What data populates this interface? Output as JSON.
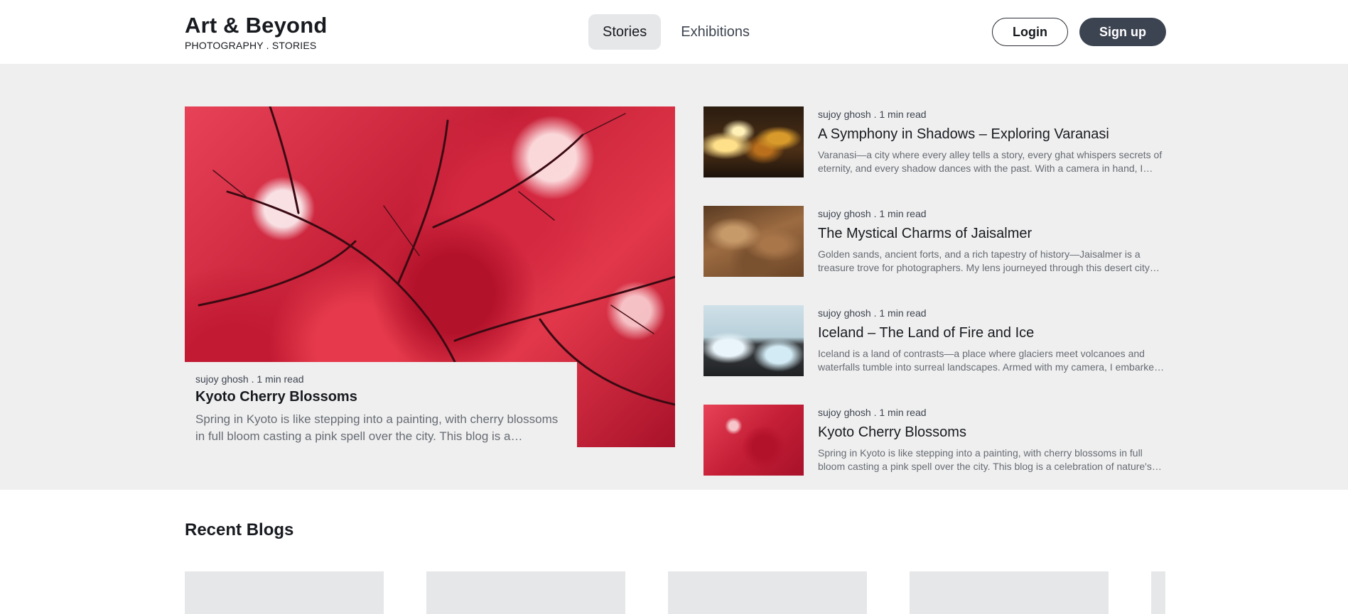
{
  "header": {
    "brand_title": "Art & Beyond",
    "brand_subtitle": "PHOTOGRAPHY . STORIES",
    "nav": [
      {
        "label": "Stories",
        "active": true
      },
      {
        "label": "Exhibitions",
        "active": false
      }
    ],
    "login_label": "Login",
    "signup_label": "Sign up"
  },
  "featured": {
    "meta": "sujoy ghosh . 1 min read",
    "title": "Kyoto Cherry Blossoms",
    "excerpt": "Spring in Kyoto is like stepping into a painting, with cherry blossoms in full bloom casting a pink spell over the city. This blog is a celebration of nature's fleeting beauty."
  },
  "stories": [
    {
      "meta": "sujoy ghosh . 1 min read",
      "title": "A Symphony in Shadows – Exploring Varanasi",
      "excerpt": "Varanasi—a city where every alley tells a story, every ghat whispers secrets of eternity, and every shadow dances with the past. With a camera in hand, I wandered through its lanes."
    },
    {
      "meta": "sujoy ghosh . 1 min read",
      "title": "The Mystical Charms of Jaisalmer",
      "excerpt": "Golden sands, ancient forts, and a rich tapestry of history—Jaisalmer is a treasure trove for photographers. My lens journeyed through this desert city and its golden streets."
    },
    {
      "meta": "sujoy ghosh . 1 min read",
      "title": "Iceland – The Land of Fire and Ice",
      "excerpt": "Iceland is a land of contrasts—a place where glaciers meet volcanoes and waterfalls tumble into surreal landscapes. Armed with my camera, I embarked on a journey across the island."
    },
    {
      "meta": "sujoy ghosh . 1 min read",
      "title": "Kyoto Cherry Blossoms",
      "excerpt": "Spring in Kyoto is like stepping into a painting, with cherry blossoms in full bloom casting a pink spell over the city. This blog is a celebration of nature's fleeting beauty."
    }
  ],
  "recent": {
    "title": "Recent Blogs"
  },
  "colors": {
    "accent": "#3c4351",
    "hero_background": "#efefef",
    "placeholder": "#e6e7e9"
  }
}
